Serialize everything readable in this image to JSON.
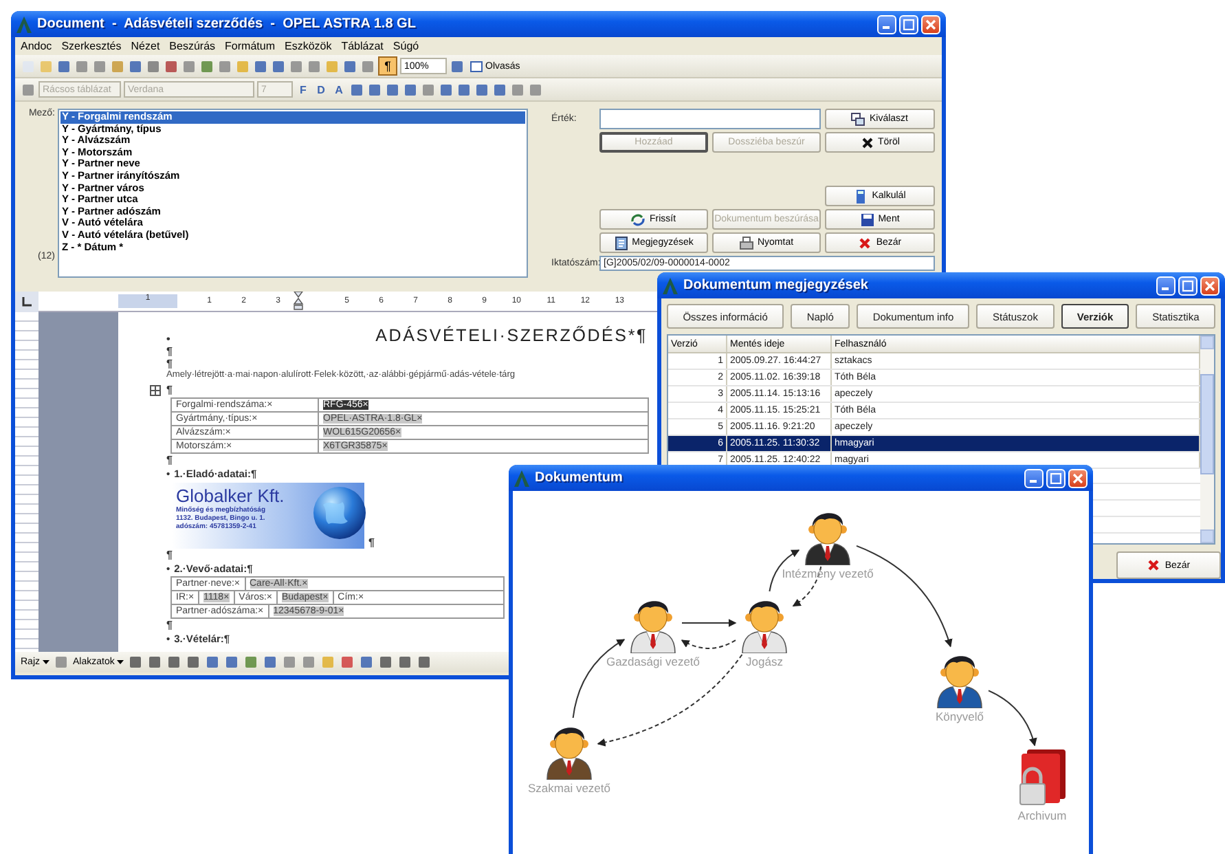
{
  "main_window": {
    "title": "Document  -  Adásvételi szerződés  -  OPEL ASTRA 1.8 GL",
    "menu": [
      "Andoc",
      "Szerkesztés",
      "Nézet",
      "Beszúrás",
      "Formátum",
      "Eszközök",
      "Táblázat",
      "Súgó"
    ],
    "toolbar": {
      "show_marks": {
        "label": "¶",
        "on": true
      },
      "zoom": "100%",
      "read_button": "Olvasás"
    },
    "format_toolbar": {
      "style": "Rácsos táblázat",
      "font": "Verdana",
      "size": "7",
      "buttons": [
        "F",
        "D",
        "A"
      ]
    },
    "fields_panel": {
      "label": "Mező:",
      "count": "(12)",
      "items": [
        {
          "label": "Y - Forgalmi rendszám",
          "selected": true
        },
        {
          "label": "Y - Gyártmány, típus",
          "selected": false
        },
        {
          "label": "Y - Alvázszám",
          "selected": false
        },
        {
          "label": "Y - Motorszám",
          "selected": false
        },
        {
          "label": "Y - Partner neve",
          "selected": false
        },
        {
          "label": "Y - Partner irányítószám",
          "selected": false
        },
        {
          "label": "Y - Partner város",
          "selected": false
        },
        {
          "label": "Y - Partner utca",
          "selected": false
        },
        {
          "label": "Y - Partner adószám",
          "selected": false
        },
        {
          "label": "V - Autó vételára",
          "selected": false
        },
        {
          "label": "V - Autó vételára (betűvel)",
          "selected": false
        },
        {
          "label": "Z - * Dátum *",
          "selected": false
        }
      ],
      "value_label": "Érték:",
      "buttons": [
        {
          "label": "Kiválaszt",
          "disabled": false,
          "focused": false
        },
        {
          "label": "Hozzáad",
          "disabled": true,
          "focused": true
        },
        {
          "label": "Dossziéba beszúr",
          "disabled": true,
          "focused": false
        },
        {
          "label": "Töröl",
          "disabled": false,
          "focused": false
        },
        {
          "label": "Kalkulál",
          "disabled": false,
          "focused": false
        },
        {
          "label": "Frissít",
          "disabled": false,
          "focused": false
        },
        {
          "label": "Dokumentum beszúrása",
          "disabled": true,
          "focused": false
        },
        {
          "label": "Ment",
          "disabled": false,
          "focused": false
        },
        {
          "label": "Megjegyzések",
          "disabled": false,
          "focused": false
        },
        {
          "label": "Nyomtat",
          "disabled": false,
          "focused": false
        },
        {
          "label": "Bezár",
          "disabled": false,
          "focused": false
        }
      ],
      "registry_label": "Iktatószám:",
      "registry_value": "[G]2005/02/09-0000014-0002"
    },
    "document": {
      "ruler": [
        "1",
        "1",
        "2",
        "3",
        "5",
        "6",
        "7",
        "8",
        "9",
        "10",
        "11",
        "12",
        "13"
      ],
      "blocks": [
        {
          "kind": "title",
          "bullet": "•",
          "text": "ADÁSVÉTELI·SZERZŐDÉS*¶"
        },
        {
          "kind": "mark",
          "text": "¶"
        },
        {
          "kind": "mark",
          "text": "¶"
        },
        {
          "kind": "text",
          "text": "Amely·létrejött·a·mai·napon·alulírott·Felek·között,·az·alábbi·gépjármű·adás-vétele·tárg"
        },
        {
          "kind": "anchor",
          "text": "¶"
        },
        {
          "kind": "table",
          "rows": [
            [
              {
                "text": "Forgalmi·rendszáma:×",
                "shaded": false,
                "selected": false
              },
              {
                "text": "RFG-456×",
                "shaded": true,
                "selected": true
              }
            ],
            [
              {
                "text": "Gyártmány,·típus:×",
                "shaded": false,
                "selected": false
              },
              {
                "text": "OPEL·ASTRA·1.8·GL×",
                "shaded": true,
                "selected": false
              }
            ],
            [
              {
                "text": "Alvázszám:×",
                "shaded": false,
                "selected": false
              },
              {
                "text": "WOL615G20656×",
                "shaded": true,
                "selected": false
              }
            ],
            [
              {
                "text": "Motorszám:×",
                "shaded": false,
                "selected": false
              },
              {
                "text": "X6TGR35875×",
                "shaded": true,
                "selected": false
              }
            ]
          ]
        },
        {
          "kind": "mark",
          "text": "¶"
        },
        {
          "kind": "heading",
          "bullet": "•",
          "text": "1.·Eladó·adatai:¶"
        },
        {
          "kind": "logo",
          "name": "Globalker Kft.",
          "lines": [
            "Minőség és megbízhatóság",
            "1132. Budapest, Bingo u. 1.",
            "adószám: 45781359-2-41"
          ],
          "after": "¶"
        },
        {
          "kind": "mark",
          "text": "¶"
        },
        {
          "kind": "heading",
          "bullet": "•",
          "text": "2.·Vevő·adatai:¶"
        },
        {
          "kind": "table",
          "rows": [
            [
              {
                "text": "Partner·neve:×",
                "shaded": false,
                "selected": false
              },
              {
                "text": "Care-All·Kft.×",
                "shaded": true,
                "selected": false
              }
            ]
          ]
        },
        {
          "kind": "table",
          "rows": [
            [
              {
                "text": "IR:×",
                "shaded": false,
                "selected": false
              },
              {
                "text": "1118×",
                "shaded": true,
                "selected": false
              },
              {
                "text": "Város:×",
                "shaded": false,
                "selected": false
              },
              {
                "text": "Budapest×",
                "shaded": true,
                "selected": false
              },
              {
                "text": "Cím:×",
                "shaded": false,
                "selected": false
              }
            ]
          ]
        },
        {
          "kind": "table",
          "rows": [
            [
              {
                "text": "Partner·adószáma:×",
                "shaded": false,
                "selected": false
              },
              {
                "text": "12345678-9-01×",
                "shaded": true,
                "selected": false
              }
            ]
          ]
        },
        {
          "kind": "mark",
          "text": "¶"
        },
        {
          "kind": "heading",
          "bullet": "•",
          "text": "3.·Vételár:¶"
        }
      ]
    },
    "drawing_toolbar": {
      "draw": "Rajz",
      "shapes": "Alakzatok"
    }
  },
  "notes_window": {
    "title": "Dokumentum megjegyzések",
    "tabs": [
      {
        "label": "Összes információ",
        "selected": false
      },
      {
        "label": "Napló",
        "selected": false
      },
      {
        "label": "Dokumentum info",
        "selected": false
      },
      {
        "label": "Státuszok",
        "selected": false
      },
      {
        "label": "Verziók",
        "selected": true
      },
      {
        "label": "Statisztika",
        "selected": false
      }
    ],
    "columns": [
      "Verzió",
      "Mentés ideje",
      "Felhasználó"
    ],
    "rows": [
      {
        "version": "1",
        "saved": "2005.09.27. 16:44:27",
        "user": "sztakacs",
        "selected": false
      },
      {
        "version": "2",
        "saved": "2005.11.02. 16:39:18",
        "user": "Tóth Béla",
        "selected": false
      },
      {
        "version": "3",
        "saved": "2005.11.14. 15:13:16",
        "user": "apeczely",
        "selected": false
      },
      {
        "version": "4",
        "saved": "2005.11.15. 15:25:21",
        "user": "Tóth Béla",
        "selected": false
      },
      {
        "version": "5",
        "saved": "2005.11.16. 9:21:20",
        "user": "apeczely",
        "selected": false
      },
      {
        "version": "6",
        "saved": "2005.11.25. 11:30:32",
        "user": "hmagyari",
        "selected": true
      },
      {
        "version": "7",
        "saved": "2005.11.25. 12:40:22",
        "user": "magyari",
        "selected": false
      }
    ],
    "close_button": "Bezár"
  },
  "flow_window": {
    "title": "Dokumentum",
    "nodes": [
      {
        "label": "Intézmény vezető",
        "kind": "person",
        "color": "#2b2b2b"
      },
      {
        "label": "Gazdasági vezető",
        "kind": "person",
        "color": "#e6e6e6"
      },
      {
        "label": "Jogász",
        "kind": "person",
        "color": "#e6e6e6"
      },
      {
        "label": "Könyvelő",
        "kind": "person",
        "color": "#1f5aa6"
      },
      {
        "label": "Szakmai vezető",
        "kind": "person",
        "color": "#6b4a2a"
      },
      {
        "label": "Archivum",
        "kind": "archive"
      }
    ]
  }
}
